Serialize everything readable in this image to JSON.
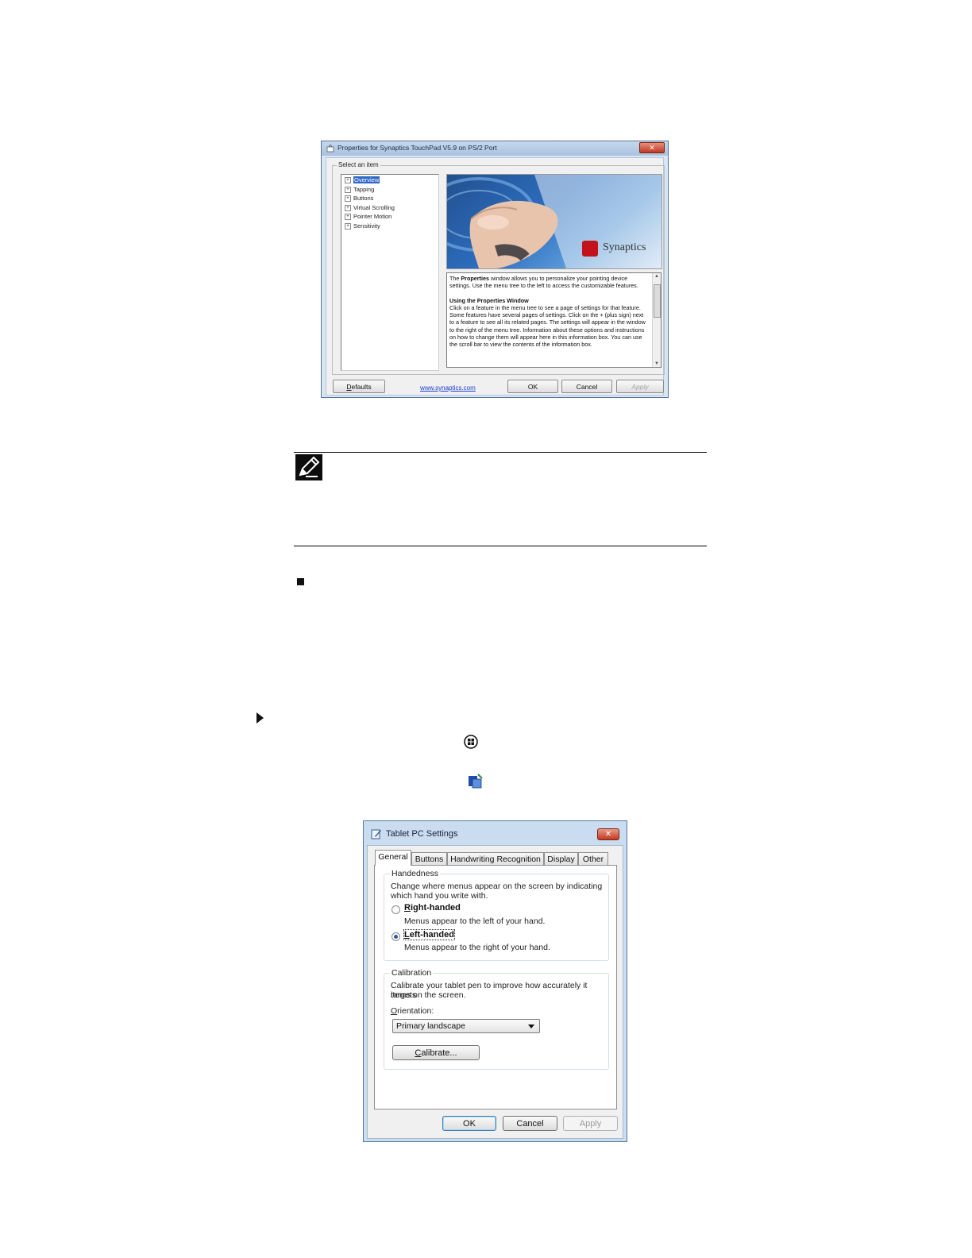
{
  "synaptics": {
    "title": "Properties for Synaptics TouchPad V5.9 on PS/2 Port",
    "close_label": "✕",
    "group_label": "Select an item",
    "tree": [
      {
        "label": "Overview",
        "selected": true
      },
      {
        "label": "Tapping"
      },
      {
        "label": "Buttons"
      },
      {
        "label": "Virtual Scrolling"
      },
      {
        "label": "Pointer Motion"
      },
      {
        "label": "Sensitivity"
      }
    ],
    "logo_text": "Synaptics",
    "info": {
      "p1_pre": "The ",
      "p1_bold": "Properties",
      "p1_post": " window allows you to personalize your pointing device settings.  Use the menu tree to the left to access the customizable features.",
      "heading": "Using the Properties Window",
      "p2": "Click on a feature in the menu tree to see a page of settings for that feature.  Some features have several pages of settings.  Click on the + (plus sign) next to a feature to see all its related pages.  The settings will appear in the window to the right of the menu tree.  Information about these options and instructions on how to change them will appear here in this information box.  You can use the scroll bar to view the contents of the information box."
    },
    "buttons": {
      "defaults": "Defaults",
      "link": "www.synaptics.com",
      "ok": "OK",
      "cancel": "Cancel",
      "apply": "Apply"
    }
  },
  "tablet": {
    "title": "Tablet PC Settings",
    "close_label": "✕",
    "tabs": [
      "General",
      "Buttons",
      "Handwriting Recognition",
      "Display",
      "Other"
    ],
    "handedness": {
      "label": "Handedness",
      "desc_line1": "Change where menus appear on the screen by indicating",
      "desc_line2": "which hand you write with.",
      "right_label_u": "R",
      "right_label_rest": "ight-handed",
      "right_desc": "Menus appear to the left of your hand.",
      "left_label_u": "L",
      "left_label_rest": "eft-handed",
      "left_desc": "Menus appear to the right of your hand.",
      "selected": "left"
    },
    "calibration": {
      "label": "Calibration",
      "desc_line1": "Calibrate your tablet pen to improve how accurately it targets",
      "desc_line2": "items on the screen.",
      "orientation_label_u": "O",
      "orientation_label_rest": "rientation:",
      "orientation_value": "Primary landscape",
      "calibrate_u": "C",
      "calibrate_rest": "alibrate..."
    },
    "buttons": {
      "ok": "OK",
      "cancel": "Cancel",
      "apply": "Apply"
    }
  }
}
